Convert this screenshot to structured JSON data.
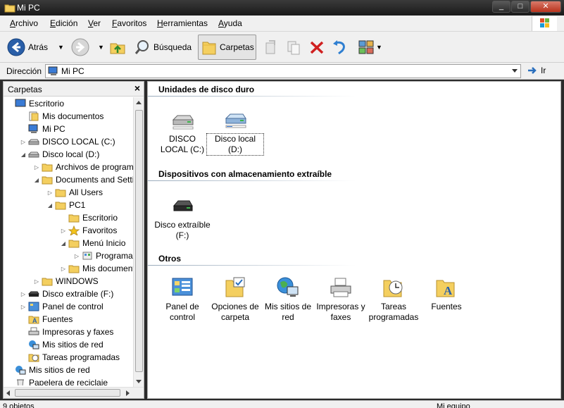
{
  "window": {
    "title": "Mi PC",
    "min": "_",
    "max": "□",
    "close": "✕"
  },
  "menu": [
    "Archivo",
    "Edición",
    "Ver",
    "Favoritos",
    "Herramientas",
    "Ayuda"
  ],
  "toolbar": {
    "back": "Atrás",
    "search": "Búsqueda",
    "folders": "Carpetas"
  },
  "address": {
    "label": "Dirección",
    "value": "Mi PC",
    "go": "Ir"
  },
  "folders_pane": {
    "title": "Carpetas",
    "close": "×",
    "tree": [
      {
        "label": "Escritorio",
        "indent": 0,
        "exp": "",
        "icon": "desktop-icon"
      },
      {
        "label": "Mis documentos",
        "indent": 1,
        "exp": "",
        "icon": "documents-icon"
      },
      {
        "label": "Mi PC",
        "indent": 1,
        "exp": "",
        "icon": "computer-icon"
      },
      {
        "label": "DISCO LOCAL  (C:)",
        "indent": 1,
        "exp": "▷",
        "icon": "drive-icon"
      },
      {
        "label": "Disco local (D:)",
        "indent": 1,
        "exp": "◢",
        "icon": "drive-icon"
      },
      {
        "label": "Archivos de programa",
        "indent": 2,
        "exp": "▷",
        "icon": "folder-icon"
      },
      {
        "label": "Documents and Settings",
        "indent": 2,
        "exp": "◢",
        "icon": "folder-icon"
      },
      {
        "label": "All Users",
        "indent": 3,
        "exp": "▷",
        "icon": "folder-icon"
      },
      {
        "label": "PC1",
        "indent": 3,
        "exp": "◢",
        "icon": "folder-icon"
      },
      {
        "label": "Escritorio",
        "indent": 4,
        "exp": "",
        "icon": "folder-icon"
      },
      {
        "label": "Favoritos",
        "indent": 4,
        "exp": "▷",
        "icon": "star-icon"
      },
      {
        "label": "Menú Inicio",
        "indent": 4,
        "exp": "◢",
        "icon": "folder-icon"
      },
      {
        "label": "Programas",
        "indent": 5,
        "exp": "▷",
        "icon": "programs-icon"
      },
      {
        "label": "Mis documentos",
        "indent": 4,
        "exp": "▷",
        "icon": "folder-icon"
      },
      {
        "label": "WINDOWS",
        "indent": 2,
        "exp": "▷",
        "icon": "folder-icon"
      },
      {
        "label": "Disco extraíble (F:)",
        "indent": 1,
        "exp": "▷",
        "icon": "removable-icon"
      },
      {
        "label": "Panel de control",
        "indent": 1,
        "exp": "▷",
        "icon": "control-panel-icon"
      },
      {
        "label": "Fuentes",
        "indent": 1,
        "exp": "",
        "icon": "fonts-icon"
      },
      {
        "label": "Impresoras y faxes",
        "indent": 1,
        "exp": "",
        "icon": "printer-icon"
      },
      {
        "label": "Mis sitios de red",
        "indent": 1,
        "exp": "",
        "icon": "network-icon"
      },
      {
        "label": "Tareas programadas",
        "indent": 1,
        "exp": "",
        "icon": "tasks-icon"
      },
      {
        "label": "Mis sitios de red",
        "indent": 0,
        "exp": "",
        "icon": "network-icon"
      },
      {
        "label": "Papelera de reciclaje",
        "indent": 0,
        "exp": "",
        "icon": "recycle-icon"
      }
    ]
  },
  "groups": [
    {
      "title": "Unidades de disco duro",
      "items": [
        {
          "label": "DISCO LOCAL  (C:)",
          "icon": "hard-drive-icon",
          "selected": false
        },
        {
          "label": "Disco local (D:)",
          "icon": "hard-drive-icon",
          "selected": true
        }
      ]
    },
    {
      "title": "Dispositivos con almacenamiento extraíble",
      "items": [
        {
          "label": "Disco extraíble (F:)",
          "icon": "removable-drive-icon",
          "selected": false
        }
      ]
    },
    {
      "title": "Otros",
      "items": [
        {
          "label": "Panel de control",
          "icon": "control-panel-icon",
          "selected": false
        },
        {
          "label": "Opciones de carpeta",
          "icon": "folder-options-icon",
          "selected": false
        },
        {
          "label": "Mis sitios de red",
          "icon": "network-icon",
          "selected": false
        },
        {
          "label": "Impresoras y faxes",
          "icon": "printer-icon",
          "selected": false
        },
        {
          "label": "Tareas programadas",
          "icon": "tasks-icon",
          "selected": false
        },
        {
          "label": "Fuentes",
          "icon": "fonts-icon",
          "selected": false
        }
      ]
    }
  ],
  "status": {
    "left": "9 objetos",
    "right": "Mi equipo"
  }
}
